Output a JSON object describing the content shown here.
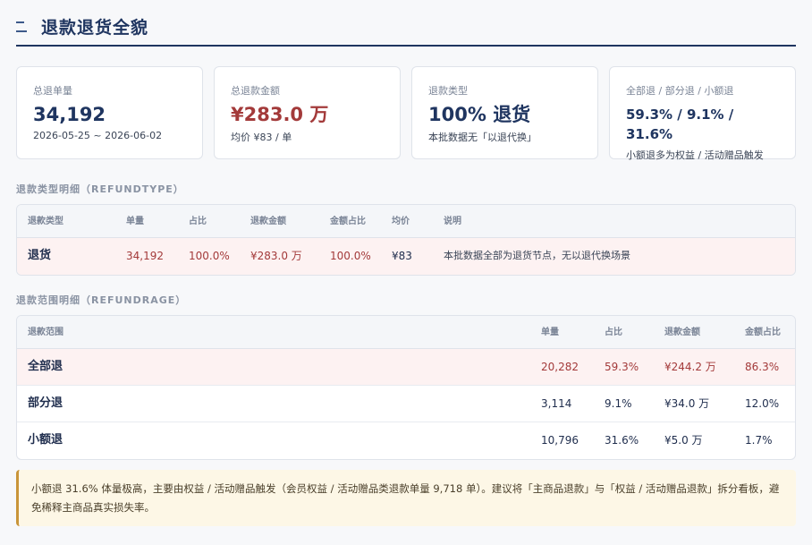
{
  "page": {
    "title": "退款退货全貌"
  },
  "cards": [
    {
      "label": "总退单量",
      "value": "34,192",
      "sub": "2026-05-25 ~ 2026-06-02"
    },
    {
      "label": "总退款金额",
      "value": "¥283.0 万",
      "sub": "均价 ¥83 / 单"
    },
    {
      "label": "退款类型",
      "value": "100% 退货",
      "sub": "本批数据无「以退代换」"
    },
    {
      "label": "全部退 / 部分退 / 小额退",
      "value": "59.3% / 9.1% / 31.6%",
      "sub": "小额退多为权益 / 活动赠品触发"
    }
  ],
  "type_section": {
    "title": "退款类型明细（REFUNDTYPE）",
    "headers": [
      "退款类型",
      "单量",
      "占比",
      "退款金额",
      "金额占比",
      "均价",
      "说明"
    ],
    "rows": [
      {
        "type": "退货",
        "count": "34,192",
        "share": "100.0%",
        "amount": "¥283.0 万",
        "amount_share": "100.0%",
        "avg": "¥83",
        "note": "本批数据全部为退货节点，无以退代换场景"
      }
    ]
  },
  "range_section": {
    "title": "退款范围明细（REFUNDRAGE）",
    "headers": [
      "退款范围",
      "单量",
      "占比",
      "退款金额",
      "金额占比"
    ],
    "rows": [
      {
        "range": "全部退",
        "count": "20,282",
        "share": "59.3%",
        "amount": "¥244.2 万",
        "amount_share": "86.3%"
      },
      {
        "range": "部分退",
        "count": "3,114",
        "share": "9.1%",
        "amount": "¥34.0 万",
        "amount_share": "12.0%"
      },
      {
        "range": "小额退",
        "count": "10,796",
        "share": "31.6%",
        "amount": "¥5.0 万",
        "amount_share": "1.7%"
      }
    ]
  },
  "insight": {
    "text": "小额退 31.6% 体量极高，主要由权益 / 活动赠品触发（会员权益 / 活动赠品类退款单量 9,718 单）。建议将「主商品退款」与「权益 / 活动赠品退款」拆分看板，避免稀释主商品真实损失率。"
  },
  "colors": {
    "accent": "#1f3560",
    "negative": "#a33a3a",
    "highlight_row": "#fdf2f2",
    "insight_bg": "#fdf7e6",
    "insight_border": "#c9953a"
  }
}
